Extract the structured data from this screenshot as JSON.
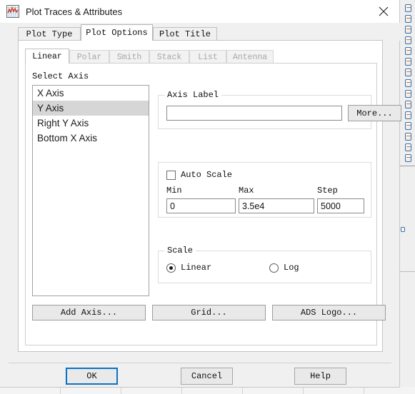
{
  "window": {
    "title": "Plot Traces & Attributes",
    "icon": "plot-chart-icon",
    "close_icon": "close-icon"
  },
  "outer_tabs": [
    {
      "label": "Plot Type",
      "active": false
    },
    {
      "label": "Plot Options",
      "active": true
    },
    {
      "label": "Plot Title",
      "active": false
    }
  ],
  "inner_tabs": [
    {
      "label": "Linear",
      "active": true
    },
    {
      "label": "Polar",
      "active": false
    },
    {
      "label": "Smith",
      "active": false
    },
    {
      "label": "Stack",
      "active": false
    },
    {
      "label": "List",
      "active": false
    },
    {
      "label": "Antenna",
      "active": false
    }
  ],
  "select_axis": {
    "label": "Select Axis",
    "items": [
      {
        "label": "X Axis",
        "selected": false
      },
      {
        "label": "Y Axis",
        "selected": true
      },
      {
        "label": "Right Y Axis",
        "selected": false
      },
      {
        "label": "Bottom X Axis",
        "selected": false
      }
    ]
  },
  "axis_label_group": {
    "title": "Axis Label",
    "input_value": "",
    "input_placeholder": "",
    "more_button": "More..."
  },
  "auto_scale_group": {
    "checkbox_label": "Auto Scale",
    "checked": false,
    "min_label": "Min",
    "max_label": "Max",
    "step_label": "Step",
    "min_value": "0",
    "max_value": "3.5e4",
    "step_value": "5000"
  },
  "scale_group": {
    "title": "Scale",
    "linear_label": "Linear",
    "log_label": "Log",
    "selected": "Linear"
  },
  "panel_buttons": {
    "add_axis": "Add Axis...",
    "grid": "Grid...",
    "ads_logo": "ADS Logo..."
  },
  "footer": {
    "ok": "OK",
    "cancel": "Cancel",
    "help": "Help"
  },
  "colors": {
    "focus_border": "#0a72c4",
    "selection": "#d6d6d6",
    "dialog_bg": "#f0f0f0",
    "panel_bg": "#ffffff"
  }
}
